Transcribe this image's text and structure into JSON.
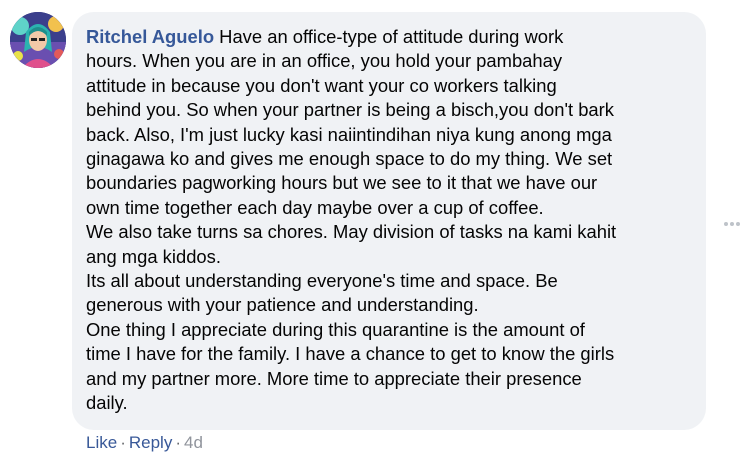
{
  "comment": {
    "author": "Ritchel Aguelo",
    "text": " Have an office-type of attitude during work\nhours. When you are in an office, you hold your pambahay\nattitude in because you don't want your co workers talking\nbehind you. So when your partner is being a bisch,you don't bark\nback. Also, I'm just lucky kasi naiintindihan niya kung anong mga\nginagawa ko and gives me enough space to do my thing. We set\nboundaries pagworking hours but we see to it that we have our\nown time together each day maybe over a cup of coffee.\nWe also take turns sa chores. May division of tasks na kami kahit\nang mga kiddos.\nIts all about understanding everyone's time and space. Be\ngenerous with your patience and understanding.\nOne thing I appreciate during this quarantine is the amount of\ntime I have for the family. I have a chance to get to know the girls\nand my partner more. More time to appreciate their presence\ndaily."
  },
  "actions": {
    "like": "Like",
    "reply": "Reply",
    "separator": "·",
    "timestamp": "4d"
  },
  "icons": {
    "avatar": "profile-photo",
    "more": "more-options-icon"
  },
  "colors": {
    "author": "#365899",
    "link": "#385898",
    "bubble": "#f0f2f5",
    "meta": "#65676b"
  }
}
